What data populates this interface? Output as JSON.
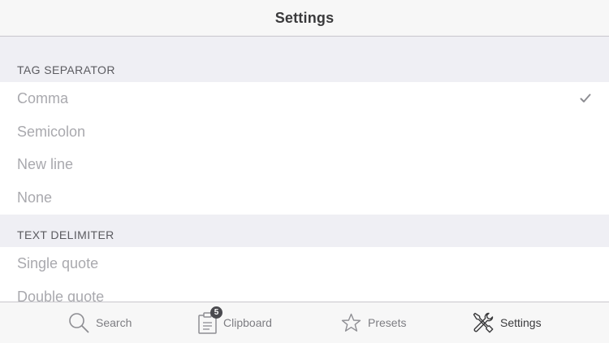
{
  "navbar": {
    "title": "Settings"
  },
  "sections": [
    {
      "header": "TAG SEPARATOR",
      "options": [
        {
          "label": "Comma",
          "selected": true
        },
        {
          "label": "Semicolon",
          "selected": false
        },
        {
          "label": "New line",
          "selected": false
        },
        {
          "label": "None",
          "selected": false
        }
      ]
    },
    {
      "header": "TEXT DELIMITER",
      "options": [
        {
          "label": "Single quote",
          "selected": false
        },
        {
          "label": "Double quote",
          "selected": false
        }
      ]
    }
  ],
  "tabbar": {
    "tabs": [
      {
        "label": "Search",
        "icon": "search-icon",
        "active": false
      },
      {
        "label": "Clipboard",
        "icon": "clipboard-icon",
        "active": false,
        "badge": "5"
      },
      {
        "label": "Presets",
        "icon": "star-icon",
        "active": false
      },
      {
        "label": "Settings",
        "icon": "tools-icon",
        "active": true
      }
    ]
  },
  "colors": {
    "background": "#efeff4",
    "row_text": "#a9a9ae",
    "header_text": "#5b5b60",
    "checkmark": "#8e8e93"
  }
}
